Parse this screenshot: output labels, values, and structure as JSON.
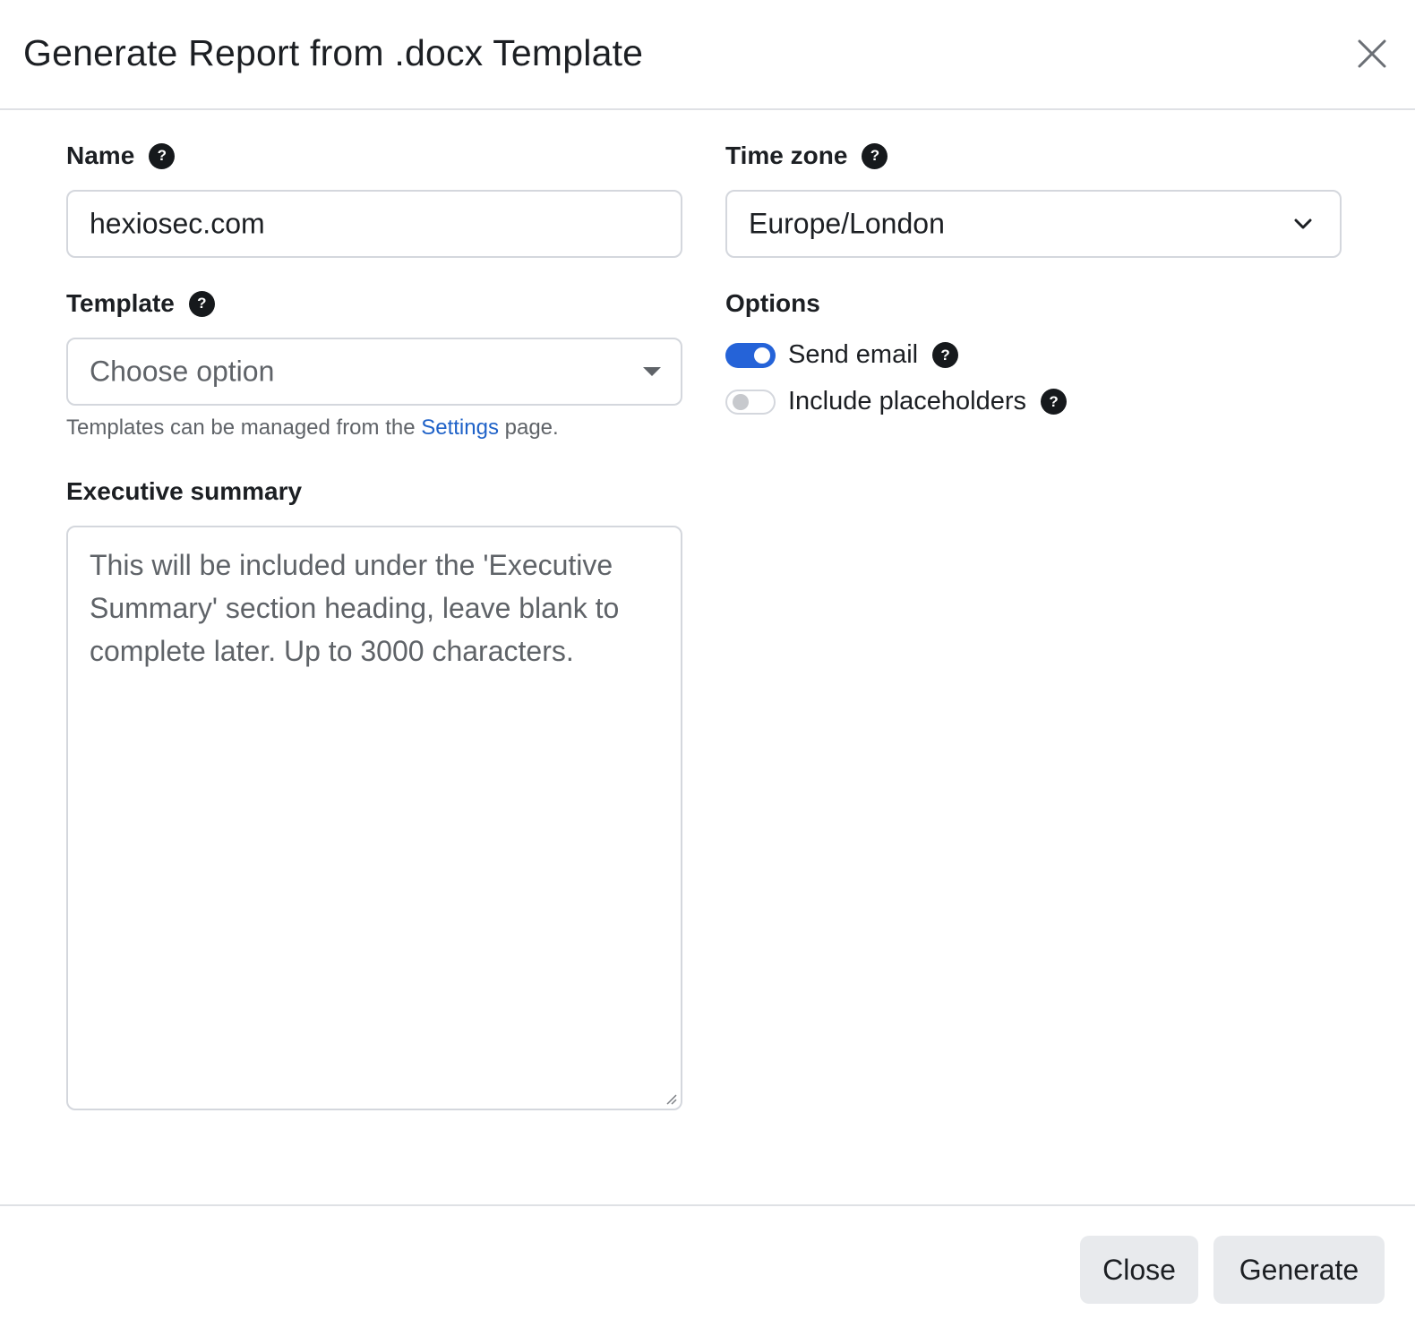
{
  "dialog": {
    "title": "Generate Report from .docx Template"
  },
  "form": {
    "name": {
      "label": "Name",
      "help": "?",
      "value": "hexiosec.com"
    },
    "time_zone": {
      "label": "Time zone",
      "help": "?",
      "value": "Europe/London"
    },
    "template": {
      "label": "Template",
      "help": "?",
      "placeholder": "Choose option",
      "hint_prefix": "Templates can be managed from the",
      "hint_link": "Settings",
      "hint_suffix": "page."
    },
    "executive_summary": {
      "label": "Executive summary",
      "placeholder": "This will be included under the 'Executive Summary' section heading, leave blank to complete later. Up to 3000 characters."
    },
    "options": {
      "label": "Options",
      "send_email": {
        "label": "Send email",
        "help": "?",
        "checked": true
      },
      "include_placeholders": {
        "label": "Include placeholders",
        "help": "?",
        "checked": false
      }
    }
  },
  "footer": {
    "close_label": "Close",
    "generate_label": "Generate"
  },
  "colors": {
    "accent": "#2563d8",
    "link": "#1f62c8",
    "help_icon_bg": "#16191c",
    "button_bg": "#e8eaed",
    "border": "#d4d7dd"
  },
  "icons": {
    "close": "close-icon",
    "help": "help-circle-icon",
    "select_caret": "caret-down-icon",
    "timezone_chevron": "chevron-down-icon"
  }
}
